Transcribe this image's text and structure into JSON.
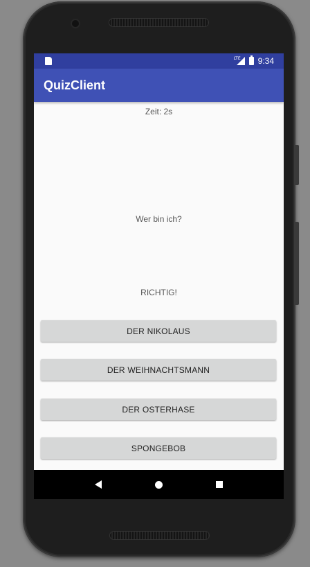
{
  "status_bar": {
    "network": "LTE",
    "time": "9:34"
  },
  "app_bar": {
    "title": "QuizClient"
  },
  "quiz": {
    "timer_text": "Zeit: 2s",
    "question": "Wer bin ich?",
    "feedback": "RICHTIG!",
    "answers": [
      "DER NIKOLAUS",
      "DER WEIHNACHTSMANN",
      "DER OSTERHASE",
      "SPONGEBOB"
    ]
  },
  "nav_bar": {
    "icons": [
      "back-icon",
      "home-icon",
      "recents-icon"
    ]
  },
  "colors": {
    "status_bar": "#303f9f",
    "app_bar": "#3f51b5",
    "button": "#d6d7d7",
    "background": "#fafafa"
  }
}
